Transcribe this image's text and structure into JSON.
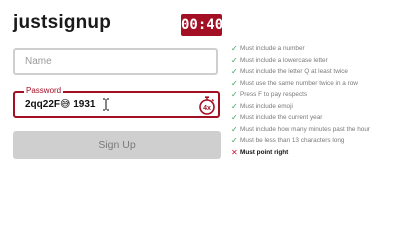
{
  "app": {
    "title": "justsignup"
  },
  "timer": {
    "value": "00:40"
  },
  "name_field": {
    "placeholder": "Name",
    "value": ""
  },
  "password_field": {
    "label": "Password",
    "value": "2qq22F😅 1931",
    "badge": "4x"
  },
  "signup_button": {
    "label": "Sign Up"
  },
  "rules": [
    {
      "text": "Must include a number",
      "status": "pass"
    },
    {
      "text": "Must include a lowercase letter",
      "status": "pass"
    },
    {
      "text": "Must include the letter Q at least twice",
      "status": "pass"
    },
    {
      "text": "Must use the same number twice in a row",
      "status": "pass"
    },
    {
      "text": "Press F to pay respects",
      "status": "pass"
    },
    {
      "text": "Must include emoji",
      "status": "pass"
    },
    {
      "text": "Must include the current year",
      "status": "pass"
    },
    {
      "text": "Must include how many minutes past the hour",
      "status": "pass"
    },
    {
      "text": "Must be less than 13 characters long",
      "status": "pass"
    },
    {
      "text": "Must point right",
      "status": "fail"
    }
  ],
  "colors": {
    "accent": "#a30f23",
    "pass": "#37a35a",
    "fail": "#c41230"
  },
  "icons": {
    "pass": "check-icon",
    "fail": "cross-icon",
    "stopwatch": "stopwatch-icon",
    "cursor": "text-cursor-icon"
  }
}
